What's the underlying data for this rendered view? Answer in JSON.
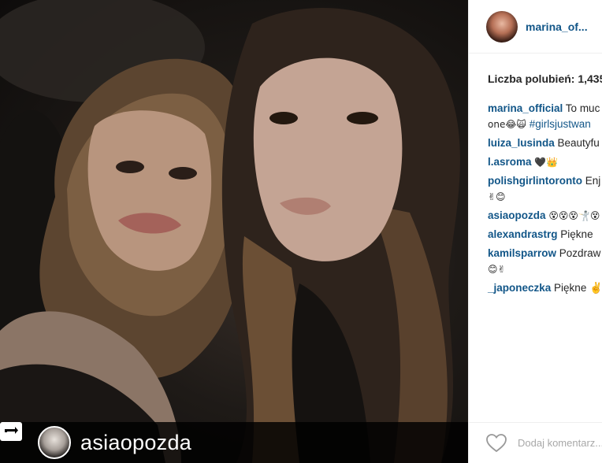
{
  "photo": {
    "repost_username": "asiaopozda"
  },
  "post": {
    "username": "marina_of...",
    "likes_label": "Liczba polubień: 1,435",
    "comments": [
      {
        "author": "marina_official",
        "text": " To muc",
        "line2": "one😂🙀 ",
        "hashtag": "#girlsjustwan"
      },
      {
        "author": "luiza_lusinda",
        "text": " Beautyfu"
      },
      {
        "author": "l.asroma",
        "text": " 🖤👑"
      },
      {
        "author": "polishgirlintoronto",
        "text": " Enj",
        "line2": "✌😊"
      },
      {
        "author": "asiaopozda",
        "text": " 😵😵😵🤺😵"
      },
      {
        "author": "alexandrastrg",
        "text": " Piękne"
      },
      {
        "author": "kamilsparrow",
        "text": " Pozdraw",
        "line2": "😊✌"
      },
      {
        "author": "_japoneczka",
        "text": " Piękne ✌"
      }
    ],
    "add_comment_placeholder": "Dodaj komentarz..."
  },
  "icons": {
    "repost": "repost-icon",
    "like": "heart-icon"
  },
  "colors": {
    "link": "#125688",
    "text": "#262626",
    "border": "#efefef"
  }
}
